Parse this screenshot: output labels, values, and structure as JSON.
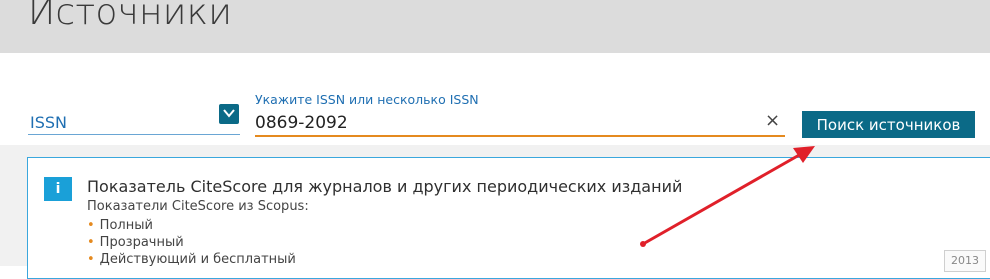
{
  "header": {
    "title": "Источники"
  },
  "search": {
    "selector_value": "ISSN",
    "field_label": "Укажите ISSN или несколько ISSN",
    "field_value": "0869-2092",
    "clear_symbol": "×",
    "submit_label": "Поиск источников"
  },
  "info": {
    "icon_text": "i",
    "title": "Показатель CiteScore для журналов и других периодических изданий",
    "subtitle": "Показатели CiteScore из Scopus:",
    "bullets": [
      "Полный",
      "Прозрачный",
      "Действующий и бесплатный"
    ]
  },
  "year_hint": "2013",
  "colors": {
    "accent": "#0b6a87",
    "info": "#1aa0d8",
    "underline": "#e58a1f",
    "arrow": "#e0202a"
  }
}
